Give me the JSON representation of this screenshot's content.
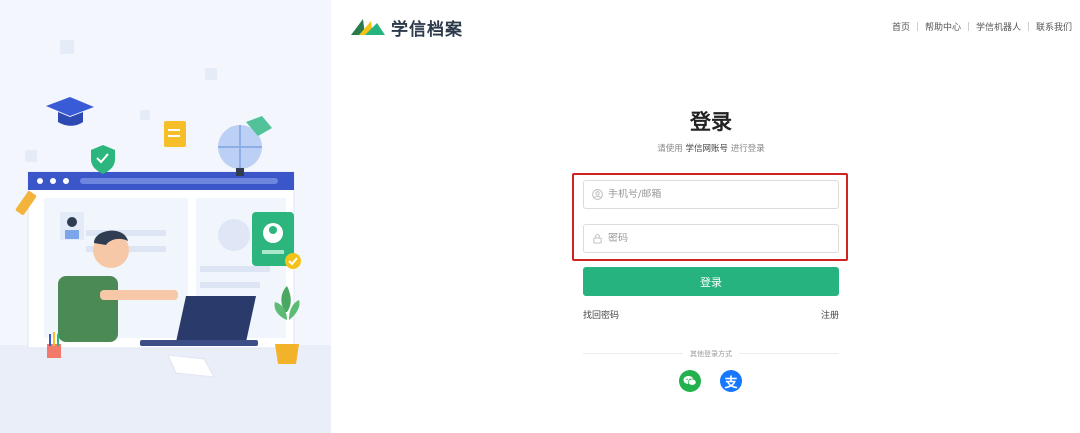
{
  "brand": {
    "name": "学信档案"
  },
  "nav": {
    "items": [
      "首页",
      "帮助中心",
      "学信机器人",
      "联系我们"
    ]
  },
  "login": {
    "title": "登录",
    "subtitle_pre": "请使用",
    "subtitle_em": "学信网账号",
    "subtitle_post": "进行登录",
    "phone_placeholder": "手机号/邮箱",
    "password_placeholder": "密码",
    "submit_label": "登录",
    "forgot_label": "找回密码",
    "register_label": "注册",
    "other_methods_label": "其他登录方式",
    "alipay_glyph": "支"
  },
  "colors": {
    "primary": "#26b37f",
    "highlight": "#d0221e",
    "wechat": "#22b14c",
    "alipay": "#1677ff"
  }
}
